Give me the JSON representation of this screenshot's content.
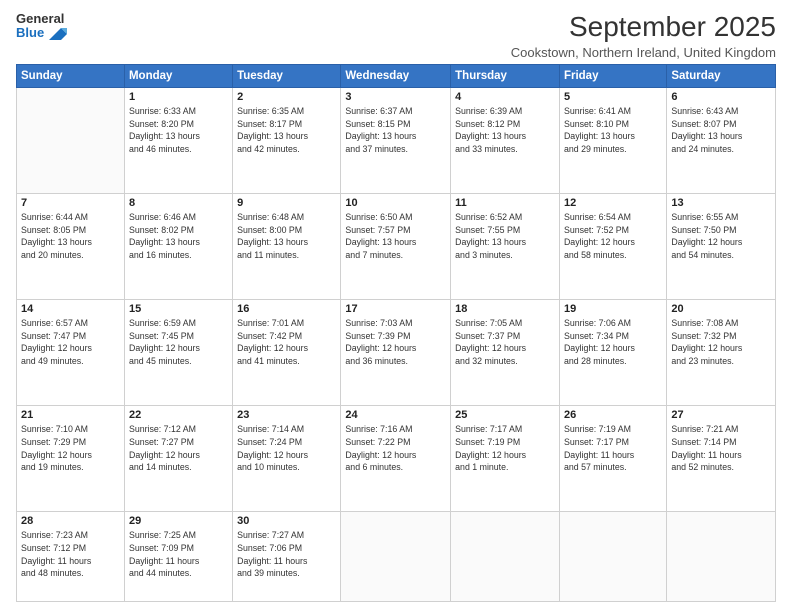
{
  "logo": {
    "line1": "General",
    "line2": "Blue"
  },
  "title": "September 2025",
  "subtitle": "Cookstown, Northern Ireland, United Kingdom",
  "days_header": [
    "Sunday",
    "Monday",
    "Tuesday",
    "Wednesday",
    "Thursday",
    "Friday",
    "Saturday"
  ],
  "weeks": [
    [
      {
        "day": "",
        "info": ""
      },
      {
        "day": "1",
        "info": "Sunrise: 6:33 AM\nSunset: 8:20 PM\nDaylight: 13 hours\nand 46 minutes."
      },
      {
        "day": "2",
        "info": "Sunrise: 6:35 AM\nSunset: 8:17 PM\nDaylight: 13 hours\nand 42 minutes."
      },
      {
        "day": "3",
        "info": "Sunrise: 6:37 AM\nSunset: 8:15 PM\nDaylight: 13 hours\nand 37 minutes."
      },
      {
        "day": "4",
        "info": "Sunrise: 6:39 AM\nSunset: 8:12 PM\nDaylight: 13 hours\nand 33 minutes."
      },
      {
        "day": "5",
        "info": "Sunrise: 6:41 AM\nSunset: 8:10 PM\nDaylight: 13 hours\nand 29 minutes."
      },
      {
        "day": "6",
        "info": "Sunrise: 6:43 AM\nSunset: 8:07 PM\nDaylight: 13 hours\nand 24 minutes."
      }
    ],
    [
      {
        "day": "7",
        "info": "Sunrise: 6:44 AM\nSunset: 8:05 PM\nDaylight: 13 hours\nand 20 minutes."
      },
      {
        "day": "8",
        "info": "Sunrise: 6:46 AM\nSunset: 8:02 PM\nDaylight: 13 hours\nand 16 minutes."
      },
      {
        "day": "9",
        "info": "Sunrise: 6:48 AM\nSunset: 8:00 PM\nDaylight: 13 hours\nand 11 minutes."
      },
      {
        "day": "10",
        "info": "Sunrise: 6:50 AM\nSunset: 7:57 PM\nDaylight: 13 hours\nand 7 minutes."
      },
      {
        "day": "11",
        "info": "Sunrise: 6:52 AM\nSunset: 7:55 PM\nDaylight: 13 hours\nand 3 minutes."
      },
      {
        "day": "12",
        "info": "Sunrise: 6:54 AM\nSunset: 7:52 PM\nDaylight: 12 hours\nand 58 minutes."
      },
      {
        "day": "13",
        "info": "Sunrise: 6:55 AM\nSunset: 7:50 PM\nDaylight: 12 hours\nand 54 minutes."
      }
    ],
    [
      {
        "day": "14",
        "info": "Sunrise: 6:57 AM\nSunset: 7:47 PM\nDaylight: 12 hours\nand 49 minutes."
      },
      {
        "day": "15",
        "info": "Sunrise: 6:59 AM\nSunset: 7:45 PM\nDaylight: 12 hours\nand 45 minutes."
      },
      {
        "day": "16",
        "info": "Sunrise: 7:01 AM\nSunset: 7:42 PM\nDaylight: 12 hours\nand 41 minutes."
      },
      {
        "day": "17",
        "info": "Sunrise: 7:03 AM\nSunset: 7:39 PM\nDaylight: 12 hours\nand 36 minutes."
      },
      {
        "day": "18",
        "info": "Sunrise: 7:05 AM\nSunset: 7:37 PM\nDaylight: 12 hours\nand 32 minutes."
      },
      {
        "day": "19",
        "info": "Sunrise: 7:06 AM\nSunset: 7:34 PM\nDaylight: 12 hours\nand 28 minutes."
      },
      {
        "day": "20",
        "info": "Sunrise: 7:08 AM\nSunset: 7:32 PM\nDaylight: 12 hours\nand 23 minutes."
      }
    ],
    [
      {
        "day": "21",
        "info": "Sunrise: 7:10 AM\nSunset: 7:29 PM\nDaylight: 12 hours\nand 19 minutes."
      },
      {
        "day": "22",
        "info": "Sunrise: 7:12 AM\nSunset: 7:27 PM\nDaylight: 12 hours\nand 14 minutes."
      },
      {
        "day": "23",
        "info": "Sunrise: 7:14 AM\nSunset: 7:24 PM\nDaylight: 12 hours\nand 10 minutes."
      },
      {
        "day": "24",
        "info": "Sunrise: 7:16 AM\nSunset: 7:22 PM\nDaylight: 12 hours\nand 6 minutes."
      },
      {
        "day": "25",
        "info": "Sunrise: 7:17 AM\nSunset: 7:19 PM\nDaylight: 12 hours\nand 1 minute."
      },
      {
        "day": "26",
        "info": "Sunrise: 7:19 AM\nSunset: 7:17 PM\nDaylight: 11 hours\nand 57 minutes."
      },
      {
        "day": "27",
        "info": "Sunrise: 7:21 AM\nSunset: 7:14 PM\nDaylight: 11 hours\nand 52 minutes."
      }
    ],
    [
      {
        "day": "28",
        "info": "Sunrise: 7:23 AM\nSunset: 7:12 PM\nDaylight: 11 hours\nand 48 minutes."
      },
      {
        "day": "29",
        "info": "Sunrise: 7:25 AM\nSunset: 7:09 PM\nDaylight: 11 hours\nand 44 minutes."
      },
      {
        "day": "30",
        "info": "Sunrise: 7:27 AM\nSunset: 7:06 PM\nDaylight: 11 hours\nand 39 minutes."
      },
      {
        "day": "",
        "info": ""
      },
      {
        "day": "",
        "info": ""
      },
      {
        "day": "",
        "info": ""
      },
      {
        "day": "",
        "info": ""
      }
    ]
  ]
}
